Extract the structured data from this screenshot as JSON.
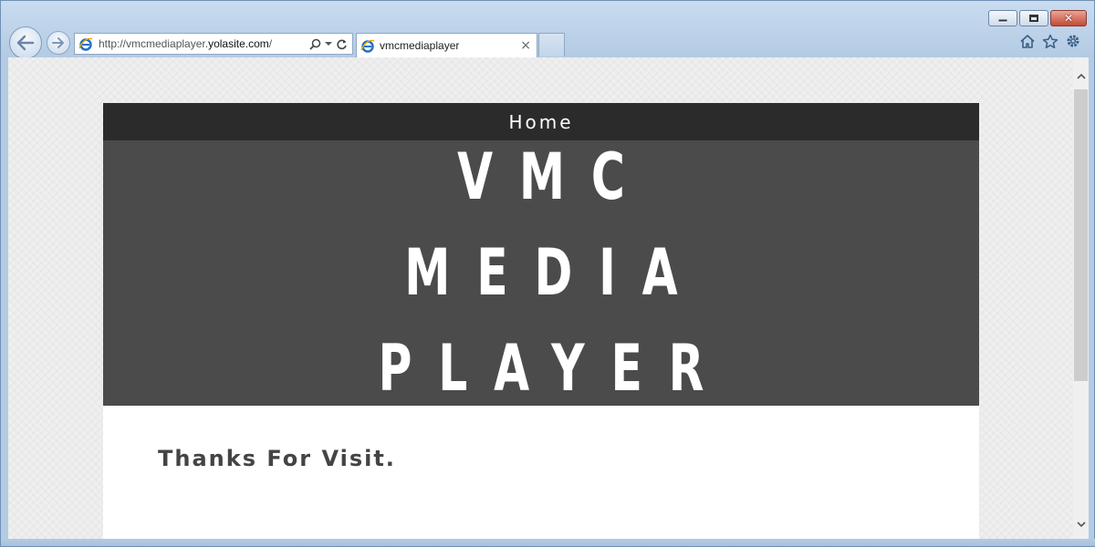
{
  "browser": {
    "url_prefix": "http://vmcmediaplayer.",
    "url_domain": "yolasite.com",
    "url_suffix": "/",
    "tab_title": "vmcmediaplayer",
    "tab_close": "×",
    "caption_close": "✕"
  },
  "site": {
    "nav_home": "Home",
    "hero_title_line1": "VMC MEDIA",
    "hero_title_line2": "PLAYER",
    "content_text": "Thanks For Visit."
  },
  "icons": {
    "back": "back-arrow-icon",
    "forward": "forward-arrow-icon",
    "ie": "ie-logo-icon",
    "search": "search-icon",
    "refresh": "refresh-icon",
    "home": "home-icon",
    "favorites": "star-icon",
    "tools": "gear-icon"
  },
  "colors": {
    "nav_bg": "#2b2b2b",
    "hero_bg": "#4b4b4b",
    "content_text": "#444444",
    "ie_blue": "#1f6fd0"
  }
}
